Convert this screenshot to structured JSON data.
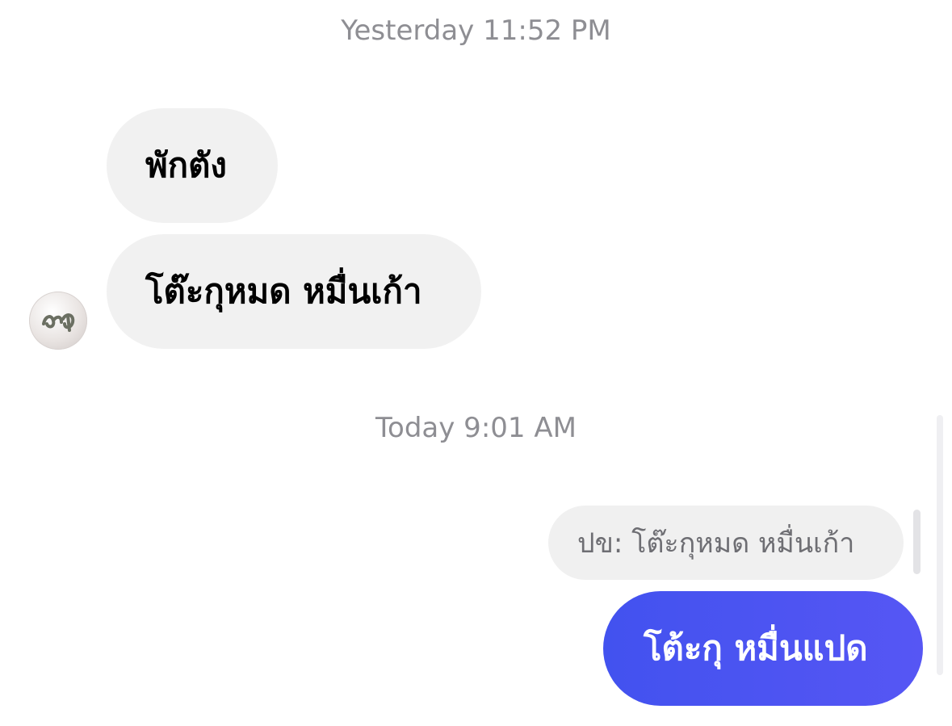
{
  "timestamps": {
    "yesterday": "Yesterday 11:52 PM",
    "today": "Today 9:01 AM"
  },
  "incoming": [
    {
      "text": "พักตัง"
    },
    {
      "text": "โต๊ะกุหมด หมื่นเก้า"
    }
  ],
  "reply": {
    "quoted_text": "ปข: โต๊ะกุหมด หมื่นเก้า"
  },
  "outgoing": [
    {
      "text": "โต้ะกุ หมื่นแปด"
    }
  ],
  "colors": {
    "incoming_bubble": "#f1f1f1",
    "outgoing_bubble_start": "#4252ef",
    "outgoing_bubble_end": "#5656f4",
    "timestamp": "#8e8e93"
  }
}
